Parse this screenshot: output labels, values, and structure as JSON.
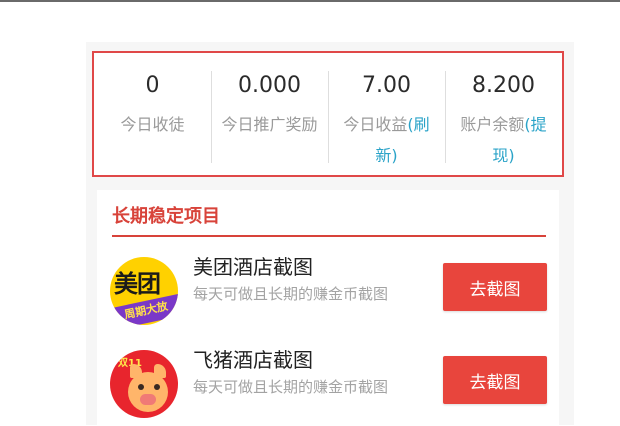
{
  "stats": [
    {
      "value": "0",
      "label": "今日收徒",
      "link": ""
    },
    {
      "value": "0.000",
      "label": "今日推广奖励",
      "link": ""
    },
    {
      "value": "7.00",
      "label": "今日收益",
      "link": "(刷新)"
    },
    {
      "value": "8.200",
      "label": "账户余额",
      "link": "(提现)"
    }
  ],
  "section": {
    "title": "长期稳定项目",
    "items": [
      {
        "name": "美团酒店截图",
        "desc": "每天可做且长期的赚金币截图",
        "button": "去截图",
        "icon": "meituan-app-icon",
        "icon_text": "美团",
        "icon_subtext": "周期大放"
      },
      {
        "name": "飞猪酒店截图",
        "desc": "每天可做且长期的赚金币截图",
        "button": "去截图",
        "icon": "fliggy-app-icon",
        "icon_text": "双11"
      }
    ]
  },
  "colors": {
    "accent_red": "#e04848",
    "button_red": "#e8453d",
    "link_blue": "#2aa3c8"
  }
}
